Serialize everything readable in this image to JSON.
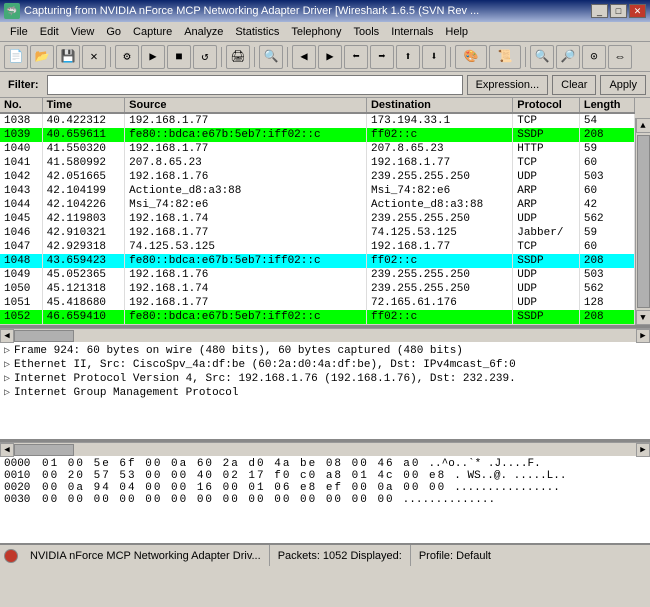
{
  "titleBar": {
    "title": "Capturing from NVIDIA nForce MCP Networking Adapter Driver   [Wireshark 1.6.5 (SVN Rev ...",
    "icon": "🦈"
  },
  "menuBar": {
    "items": [
      "File",
      "Edit",
      "View",
      "Go",
      "Capture",
      "Analyze",
      "Statistics",
      "Telephony",
      "Tools",
      "Internals",
      "Help"
    ]
  },
  "filterBar": {
    "label": "Filter:",
    "placeholder": "",
    "value": "",
    "expressionBtn": "Expression...",
    "clearBtn": "Clear",
    "applyBtn": "Apply"
  },
  "packetList": {
    "columns": [
      "No.",
      "Time",
      "Source",
      "Destination",
      "Protocol",
      "Length"
    ],
    "rows": [
      {
        "no": "1038",
        "time": "40.422312",
        "src": "192.168.1.77",
        "dst": "173.194.33.1",
        "proto": "TCP",
        "len": "54",
        "style": "normal"
      },
      {
        "no": "1039",
        "time": "40.659611",
        "src": "fe80::bdca:e67b:5eb7:iff02::c",
        "dst": "ff02::c",
        "proto": "SSDP",
        "len": "208",
        "style": "green"
      },
      {
        "no": "1040",
        "time": "41.550320",
        "src": "192.168.1.77",
        "dst": "207.8.65.23",
        "proto": "HTTP",
        "len": "59",
        "style": "normal"
      },
      {
        "no": "1041",
        "time": "41.580992",
        "src": "207.8.65.23",
        "dst": "192.168.1.77",
        "proto": "TCP",
        "len": "60",
        "style": "normal"
      },
      {
        "no": "1042",
        "time": "42.051665",
        "src": "192.168.1.76",
        "dst": "239.255.255.250",
        "proto": "UDP",
        "len": "503",
        "style": "normal"
      },
      {
        "no": "1043",
        "time": "42.104199",
        "src": "Actionte_d8:a3:88",
        "dst": "Msi_74:82:e6",
        "proto": "ARP",
        "len": "60",
        "style": "normal"
      },
      {
        "no": "1044",
        "time": "42.104226",
        "src": "Msi_74:82:e6",
        "dst": "Actionte_d8:a3:88",
        "proto": "ARP",
        "len": "42",
        "style": "normal"
      },
      {
        "no": "1045",
        "time": "42.119803",
        "src": "192.168.1.74",
        "dst": "239.255.255.250",
        "proto": "UDP",
        "len": "562",
        "style": "normal"
      },
      {
        "no": "1046",
        "time": "42.910321",
        "src": "192.168.1.77",
        "dst": "74.125.53.125",
        "proto": "Jabber/",
        "len": "59",
        "style": "normal"
      },
      {
        "no": "1047",
        "time": "42.929318",
        "src": "74.125.53.125",
        "dst": "192.168.1.77",
        "proto": "TCP",
        "len": "60",
        "style": "normal"
      },
      {
        "no": "1048",
        "time": "43.659423",
        "src": "fe80::bdca:e67b:5eb7:iff02::c",
        "dst": "ff02::c",
        "proto": "SSDP",
        "len": "208",
        "style": "cyan"
      },
      {
        "no": "1049",
        "time": "45.052365",
        "src": "192.168.1.76",
        "dst": "239.255.255.250",
        "proto": "UDP",
        "len": "503",
        "style": "normal"
      },
      {
        "no": "1050",
        "time": "45.121318",
        "src": "192.168.1.74",
        "dst": "239.255.255.250",
        "proto": "UDP",
        "len": "562",
        "style": "normal"
      },
      {
        "no": "1051",
        "time": "45.418680",
        "src": "192.168.1.77",
        "dst": "72.165.61.176",
        "proto": "UDP",
        "len": "128",
        "style": "normal"
      },
      {
        "no": "1052",
        "time": "46.659410",
        "src": "fe80::bdca:e67b:5eb7:iff02::c",
        "dst": "ff02::c",
        "proto": "SSDP",
        "len": "208",
        "style": "green"
      }
    ]
  },
  "detailPanel": {
    "rows": [
      {
        "expanded": false,
        "text": "Frame 924: 60 bytes on wire (480 bits), 60 bytes captured (480 bits)"
      },
      {
        "expanded": false,
        "text": "Ethernet II, Src: CiscoSpv_4a:df:be (60:2a:d0:4a:df:be), Dst: IPv4mcast_6f:0"
      },
      {
        "expanded": false,
        "text": "Internet Protocol Version 4, Src: 192.168.1.76 (192.168.1.76), Dst: 232.239."
      },
      {
        "expanded": false,
        "text": "Internet Group Management Protocol"
      }
    ]
  },
  "hexPanel": {
    "rows": [
      {
        "offset": "0000",
        "bytes": "01 00 5e 6f 00 0a 60 2a  d0 4a be 08 00 46 a0",
        "ascii": "..^o..`* .J....F."
      },
      {
        "offset": "0010",
        "bytes": "00 20 57 53 00 00 40 02  17 f0 c0 a8 01 4c 00 e8",
        "ascii": ". WS..@. .....L.."
      },
      {
        "offset": "0020",
        "bytes": "00 0a 94 04 00 00 16 00  01 06 e8 ef 00 0a 00 00",
        "ascii": "................ "
      },
      {
        "offset": "0030",
        "bytes": "00 00 00 00 00 00 00 00  00 00 00 00 00 00",
        "ascii": "..............  "
      }
    ]
  },
  "statusBar": {
    "adapter": "NVIDIA nForce MCP Networking Adapter Driv...",
    "packets": "Packets: 1052 Displayed:",
    "profile": "Profile: Default"
  }
}
